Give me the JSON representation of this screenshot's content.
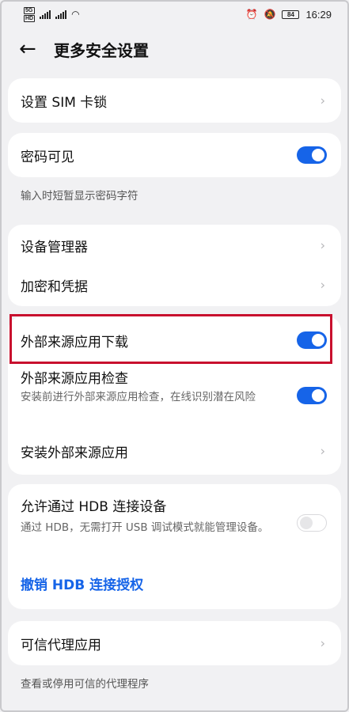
{
  "status_bar": {
    "sim1": "5G",
    "sim2": "HD",
    "battery": "84",
    "time": "16:29"
  },
  "header": {
    "title": "更多安全设置"
  },
  "items": {
    "sim_lock": "设置 SIM 卡锁",
    "password_visible": "密码可见",
    "password_visible_caption": "输入时短暂显示密码字符",
    "device_manager": "设备管理器",
    "encryption": "加密和凭据",
    "external_download": "外部来源应用下载",
    "external_check": "外部来源应用检查",
    "external_check_sub": "安装前进行外部来源应用检查，在线识别潜在风险",
    "install_external": "安装外部来源应用",
    "hdb_connect": "允许通过 HDB 连接设备",
    "hdb_connect_sub": "通过 HDB，无需打开 USB 调试模式就能管理设备。",
    "hdb_revoke": "撤销 HDB 连接授权",
    "trusted_agent": "可信代理应用",
    "trusted_agent_caption": "查看或停用可信的代理程序"
  },
  "toggles": {
    "password_visible": true,
    "external_download": true,
    "external_check": true,
    "hdb_connect": false
  },
  "colors": {
    "accent": "#1664e8",
    "highlight": "#c8102e"
  }
}
